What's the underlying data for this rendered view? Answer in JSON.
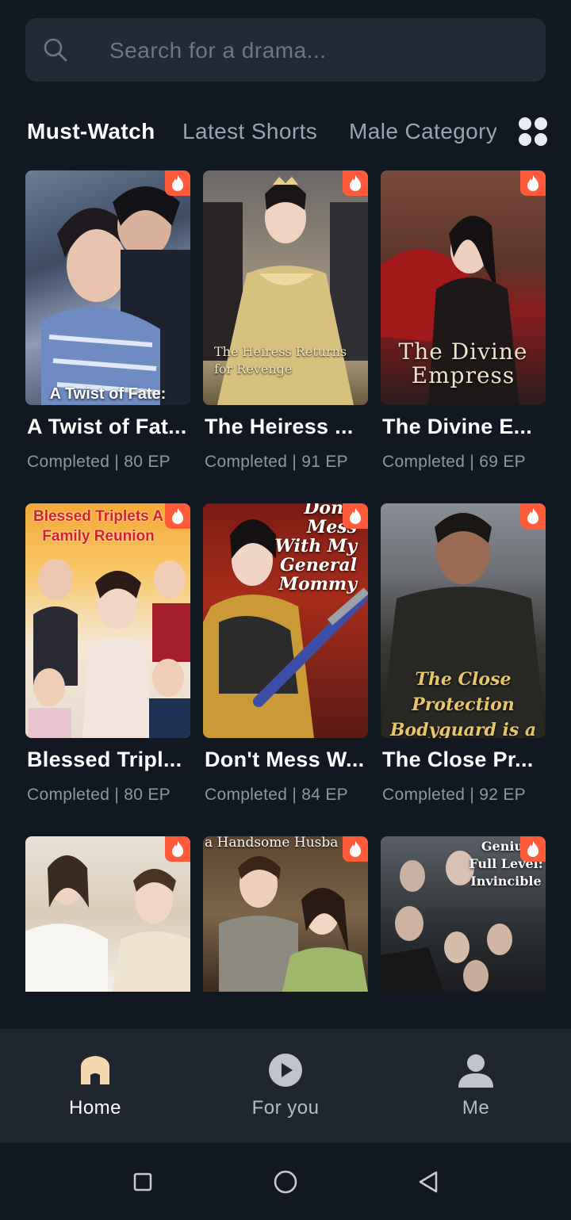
{
  "search": {
    "placeholder": "Search for a drama..."
  },
  "tabs": [
    {
      "label": "Must-Watch",
      "active": true
    },
    {
      "label": "Latest Shorts",
      "active": false
    },
    {
      "label": "Male Category",
      "active": false
    }
  ],
  "dramas": [
    {
      "title": "A Twist of Fat...",
      "meta": "Completed | 80 EP",
      "poster_text": "A Twist of Fate:"
    },
    {
      "title": "The Heiress ...",
      "meta": "Completed | 91 EP",
      "poster_text": "The Heiress Returns for Revenge"
    },
    {
      "title": "The Divine E...",
      "meta": "Completed | 69 EP",
      "poster_text": "The Divine Empress"
    },
    {
      "title": "Blessed Tripl...",
      "meta": "Completed | 80 EP",
      "poster_text": "Blessed Triplets A Family Reunion"
    },
    {
      "title": "Don't Mess W...",
      "meta": "Completed | 84 EP",
      "poster_text": "Don't Mess With My General Mommy"
    },
    {
      "title": "The Close Pr...",
      "meta": "Completed | 92 EP",
      "poster_text": "The Close Protection Bodyguard is a War Lord"
    },
    {
      "title": "",
      "meta": "",
      "poster_text": ""
    },
    {
      "title": "",
      "meta": "",
      "poster_text": "a Handsome Husba"
    },
    {
      "title": "",
      "meta": "",
      "poster_text": "Genius Full Level: Invincible"
    }
  ],
  "nav": [
    {
      "label": "Home",
      "icon": "home-icon",
      "active": true
    },
    {
      "label": "For you",
      "icon": "play-icon",
      "active": false
    },
    {
      "label": "Me",
      "icon": "person-icon",
      "active": false
    }
  ],
  "colors": {
    "background": "#121821",
    "accent_hot": "#ff5a3a",
    "home_icon": "#f6d7ad"
  }
}
